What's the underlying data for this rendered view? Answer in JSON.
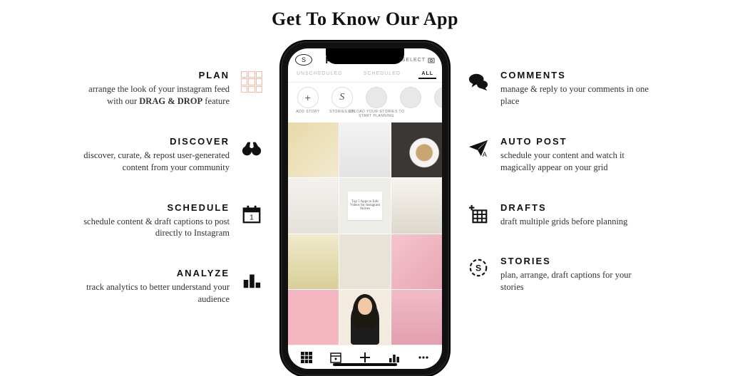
{
  "hero": {
    "title": "Get To Know Our App"
  },
  "left_features": [
    {
      "heading": "PLAN",
      "desc_pre": "arrange the look of your instagram feed with our ",
      "desc_bold": "DRAG & DROP",
      "desc_post": " feature"
    },
    {
      "heading": "DISCOVER",
      "desc_pre": "discover, curate, & repost user-generated content from your community",
      "desc_bold": "",
      "desc_post": ""
    },
    {
      "heading": "SCHEDULE",
      "desc_pre": "schedule content & draft captions to post directly to Instagram",
      "desc_bold": "",
      "desc_post": ""
    },
    {
      "heading": "ANALYZE",
      "desc_pre": "track analytics to better understand your audience",
      "desc_bold": "",
      "desc_post": ""
    }
  ],
  "right_features": [
    {
      "heading": "COMMENTS",
      "desc_pre": "manage & reply to your comments in one place",
      "desc_bold": "",
      "desc_post": ""
    },
    {
      "heading": "AUTO POST",
      "desc_pre": "schedule your content and watch it magically appear on your grid",
      "desc_bold": "",
      "desc_post": ""
    },
    {
      "heading": "DRAFTS",
      "desc_pre": "draft multiple grids before planning",
      "desc_bold": "",
      "desc_post": ""
    },
    {
      "heading": "STORIES",
      "desc_pre": "plan, arrange, draft captions for your stories",
      "desc_bold": "",
      "desc_post": ""
    }
  ],
  "phone": {
    "brand": "PLANOLY",
    "select_label": "SELECT",
    "profile_glyph": "S",
    "tabs": [
      {
        "label": "UNSCHEDULED",
        "active": false
      },
      {
        "label": "SCHEDULED",
        "active": false
      },
      {
        "label": "ALL",
        "active": true
      }
    ],
    "stories": [
      {
        "label": "ADD STORY",
        "glyph": "+",
        "kind": "add"
      },
      {
        "label": "STORIES.CO",
        "glyph": "S",
        "kind": "s"
      },
      {
        "label": "",
        "glyph": "",
        "kind": "plain"
      },
      {
        "label": "",
        "glyph": "",
        "kind": "plain"
      },
      {
        "label": "",
        "glyph": "",
        "kind": "plain"
      }
    ],
    "story_hint": "UPLOAD YOUR STORIES TO START PLANNING",
    "tile5_caption": "Top 5 Apps to Edit Videos for Instagram Stories"
  }
}
